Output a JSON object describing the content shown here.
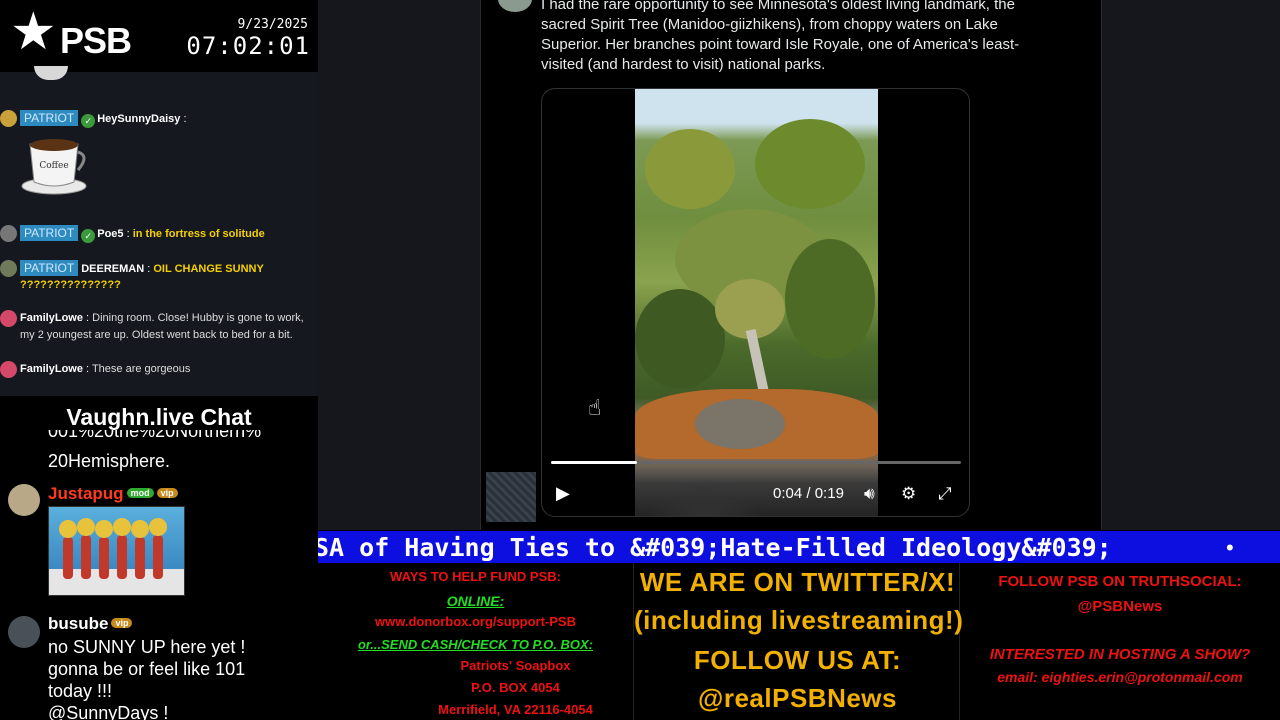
{
  "header": {
    "logo_text": "PSB",
    "date": "9/23/2025",
    "time": "07:02:01"
  },
  "chat_top": {
    "messages": [
      {
        "badge": "PATRIOT",
        "user": "HeySunnyDaisy",
        "text": ""
      },
      {
        "badge": "PATRIOT",
        "user": "Poe5",
        "text": "in the fortress of solitude"
      },
      {
        "badge": "PATRIOT",
        "user": "DEEREMAN",
        "text": "OIL CHANGE SUNNY",
        "text2": "???????????????"
      },
      {
        "user": "FamilyLowe",
        "text": "Dining room. Close! Hubby is gone to work,",
        "text2": "my 2 youngest are up. Oldest went back to bed for a bit."
      },
      {
        "user": "FamilyLowe",
        "text": "These are gorgeous"
      }
    ],
    "separator": ":",
    "coffee_label": "Coffee"
  },
  "vaughn_chat": {
    "title": "Vaughn.live Chat",
    "partial_text_1": "001%20the%20Northern%",
    "partial_text_2": "20Hemisphere.",
    "messages": [
      {
        "user": "Justapug",
        "badges": [
          "mod",
          "vip"
        ],
        "user_color": "#ff3b1f"
      },
      {
        "user": "busube",
        "badges": [
          "vip"
        ],
        "user_color": "#ffffff",
        "lines": [
          "no SUNNY UP here yet !",
          "gonna be or feel like 101",
          "today !!!",
          "@SunnyDays !"
        ]
      }
    ]
  },
  "post": {
    "lines": [
      "I had the rare opportunity to see Minnesota's oldest living landmark, the",
      "sacred Spirit Tree (Manidoo-giizhikens), from choppy waters on Lake",
      "Superior. Her branches point toward Isle Royale, one of America's least-",
      "visited (and hardest to visit) national parks."
    ],
    "video": {
      "current_time": "0:04",
      "duration": "0:19",
      "time_separator": " / ",
      "progress_fraction": 0.21
    }
  },
  "ticker": {
    "text": "SA of Having Ties to &#039;Hate-Filled Ideology&#039;",
    "dot": "•"
  },
  "fund": {
    "heading": "WAYS TO HELP FUND PSB:",
    "online_label": "ONLINE:",
    "online_url": "www.donorbox.org/support-PSB",
    "mail_label": "or...SEND CASH/CHECK TO P.O. BOX:",
    "address_1": "Patriots' Soapbox",
    "address_2": "P.O. BOX 4054",
    "address_3": "Merrifield, VA 22116-4054"
  },
  "twitter": {
    "line_1": "WE ARE ON TWITTER/X!",
    "line_2": "(including livestreaming!)",
    "line_3": "FOLLOW US AT:",
    "line_4": "@realPSBNews"
  },
  "truthsocial": {
    "line_1": "FOLLOW PSB ON TRUTHSOCIAL:",
    "line_2": "@PSBNews",
    "line_3": "INTERESTED IN HOSTING A SHOW?",
    "line_4": "email: eighties.erin@protonmail.com"
  },
  "colors": {
    "patriot_badge": "#2e8bc0",
    "ticker_bg": "#0d0ee0",
    "fund_red": "#ee1111",
    "fund_green": "#22dd22",
    "twitter_gold": "#f2b100"
  }
}
